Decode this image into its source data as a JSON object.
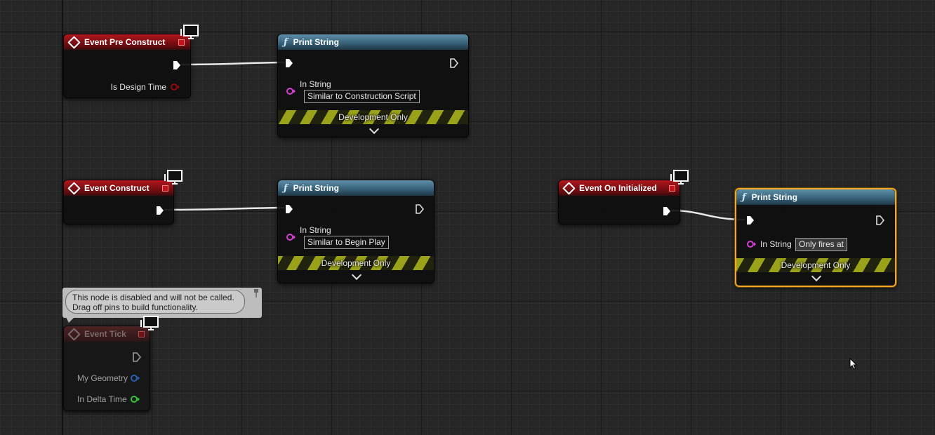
{
  "graph": {
    "nodes": {
      "pre_construct": {
        "title": "Event Pre Construct",
        "pins": {
          "design_time": "Is Design Time"
        }
      },
      "print1": {
        "title": "Print String",
        "in_label": "In String",
        "value": "Similar to Construction Script",
        "footer": "Development Only"
      },
      "construct": {
        "title": "Event Construct"
      },
      "print2": {
        "title": "Print String",
        "in_label": "In String",
        "value": "Similar to Begin Play",
        "footer": "Development Only"
      },
      "on_initialized": {
        "title": "Event On Initialized"
      },
      "print3": {
        "title": "Print String",
        "in_label": "In String",
        "value": "Only fires at",
        "footer": "Development Only"
      },
      "tick": {
        "title": "Event Tick",
        "pins": {
          "geometry": "My Geometry",
          "delta": "In Delta Time"
        }
      }
    },
    "comment": {
      "line1": "This node is disabled and will not be called.",
      "line2": "Drag off pins to build functionality."
    },
    "colors": {
      "event_header": "#b0161c",
      "function_header": "#5d8ea8",
      "selection": "#f5a623",
      "string_pin": "#d53fd5",
      "struct_pin": "#2a5fb0",
      "float_pin": "#33c43a",
      "bool_pin": "#8f0b0b"
    },
    "icons": [
      "event-diamond-icon",
      "function-icon",
      "monitor-icon",
      "exec-pin-icon",
      "chevron-down-icon",
      "pushpin-icon",
      "mouse-cursor-icon"
    ]
  }
}
